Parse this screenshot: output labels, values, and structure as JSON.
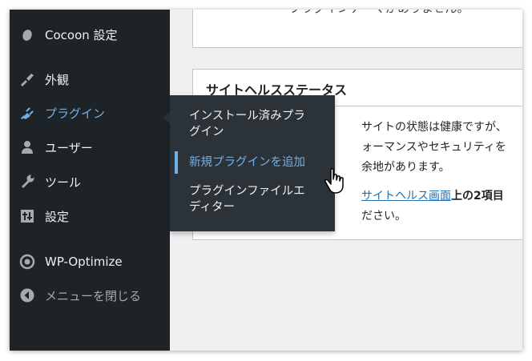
{
  "sidebar": {
    "items": [
      {
        "label": "Cocoon 設定",
        "icon": "cocoon-icon"
      },
      {
        "label": "外観",
        "icon": "paintbrush-icon"
      },
      {
        "label": "プラグイン",
        "icon": "plugin-icon"
      },
      {
        "label": "ユーザー",
        "icon": "users-icon"
      },
      {
        "label": "ツール",
        "icon": "wrench-icon"
      },
      {
        "label": "設定",
        "icon": "settings-icon"
      },
      {
        "label": "WP-Optimize",
        "icon": "wp-optimize-icon"
      },
      {
        "label": "メニューを閉じる",
        "icon": "collapse-arrow-icon"
      }
    ]
  },
  "submenu": {
    "items": [
      {
        "line1": "インストール済みプラ",
        "line2": "グイン"
      },
      {
        "line1": "新規プラグインを追加"
      },
      {
        "line1": "プラグインファイルエ",
        "line2": "ディター"
      }
    ]
  },
  "top_box": {
    "clipped_text": "プラグインテーマがありません。"
  },
  "site_health": {
    "title": "サイトヘルスステータス",
    "line1": "サイトの状態は健康ですが、",
    "line2": "ォーマンスやセキュリティを",
    "line3": "余地があります。",
    "link": "サイトヘルス画面",
    "line4_rest": "上の2項目",
    "line5": "ださい。"
  },
  "colors": {
    "sidebar_bg": "#1d2327",
    "submenu_bg": "#2c3338",
    "accent": "#72aee6",
    "link": "#2271b1"
  }
}
